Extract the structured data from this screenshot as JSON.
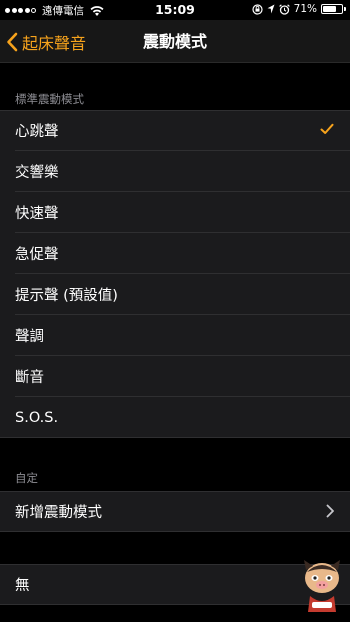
{
  "status_bar": {
    "carrier": "遠傳電信",
    "time": "15:09",
    "battery": "71%",
    "battery_level": 0.71
  },
  "nav": {
    "back_label": "起床聲音",
    "title": "震動模式"
  },
  "sections": [
    {
      "header": "標準震動模式",
      "items": [
        {
          "label": "心跳聲",
          "selected": true
        },
        {
          "label": "交響樂"
        },
        {
          "label": "快速聲"
        },
        {
          "label": "急促聲"
        },
        {
          "label": "提示聲 (預設值)"
        },
        {
          "label": "聲調"
        },
        {
          "label": "斷音"
        },
        {
          "label": "S.O.S."
        }
      ]
    },
    {
      "header": "自定",
      "items": [
        {
          "label": "新增震動模式",
          "disclosure": true
        }
      ]
    },
    {
      "header": "",
      "items": [
        {
          "label": "無"
        }
      ]
    }
  ],
  "colors": {
    "accent": "#f7a31c",
    "background": "#000000",
    "cell": "#1b1b1d",
    "separator": "#2f2f31",
    "section_header": "#8d8d93"
  }
}
